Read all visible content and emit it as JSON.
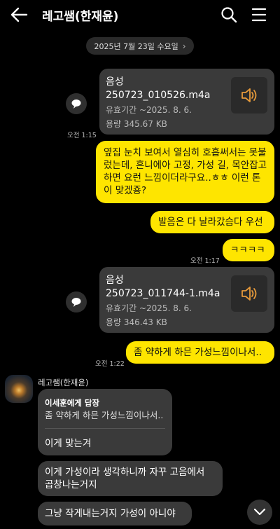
{
  "header": {
    "title": "레고쌤(한재윤)",
    "icons": [
      "back-arrow-icon",
      "search-icon",
      "menu-icon"
    ]
  },
  "date_divider": {
    "label": "2025년 7월 23일 수요일",
    "chevron": "›"
  },
  "messages": {
    "file1": {
      "label": "음성",
      "filename": "250723_010526.m4a",
      "expiry": "유효기간 ~2025. 8. 6.",
      "size": "용량  345.67 KB",
      "time": "오전 1:15"
    },
    "msg1": {
      "text": "옆집 눈치 보여서 열심히 호흡써서는 못불렀는데, 흔니에아 고정, 가성 길, 목안잡고 하면 요런 느낌이더라구요..ㅎㅎ 이런 톤이 맞겠죵?"
    },
    "msg2": {
      "text": "발음은 다 날라갔슴다 우선"
    },
    "msg3": {
      "text": "ㅋㅋㅋㅋ",
      "time": "오전 1:17"
    },
    "file2": {
      "label": "음성",
      "filename": "250723_011744-1.m4a",
      "expiry": "유효기간 ~2025. 8. 6.",
      "size": "용량  346.43 KB"
    },
    "msg4": {
      "text": "좀 약하게 하믄 가성느낌이나서..",
      "time": "오전 1:22"
    },
    "sender_name": "레고쌤(한재윤)",
    "reply": {
      "header": "이세훈에게 답장",
      "quote": "좀 약하게 하믄 가성느낌이나서..",
      "text": "이게 맞는겨"
    },
    "msg5": {
      "line1": "이게 가성이라 생각하니까 자꾸 고음에서",
      "line2": "곱창나는거지"
    },
    "msg6": {
      "text": "그냥 작게내는거지 가성이 아니야"
    }
  },
  "colors": {
    "my_bubble": "#fee500",
    "other_bubble": "#3a3a3a",
    "background": "#000000"
  }
}
